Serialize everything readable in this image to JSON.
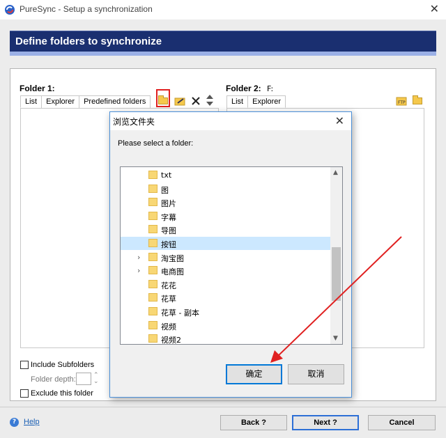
{
  "window": {
    "title": "PureSync - Setup a synchronization",
    "close": "✕"
  },
  "header": {
    "title": "Define folders to synchronize"
  },
  "folder1": {
    "label": "Folder 1:",
    "tabs": [
      "List",
      "Explorer",
      "Predefined folders"
    ]
  },
  "folder2": {
    "label": "Folder 2:",
    "drive": "F:",
    "tabs": [
      "List",
      "Explorer"
    ]
  },
  "options": {
    "include_subfolders": "Include Subfolders",
    "folder_depth": "Folder depth:",
    "exclude_folder": "Exclude this folder"
  },
  "footer": {
    "help": "Help",
    "back": "Back ?",
    "next": "Next ?",
    "cancel": "Cancel"
  },
  "dialog": {
    "title": "浏览文件夹",
    "prompt": "Please select a folder:",
    "folders": [
      {
        "name": "txt",
        "expandable": false,
        "selected": false
      },
      {
        "name": "图",
        "expandable": false,
        "selected": false
      },
      {
        "name": "图片",
        "expandable": false,
        "selected": false
      },
      {
        "name": "字幕",
        "expandable": false,
        "selected": false
      },
      {
        "name": "导图",
        "expandable": false,
        "selected": false
      },
      {
        "name": "按钮",
        "expandable": false,
        "selected": true
      },
      {
        "name": "淘宝图",
        "expandable": true,
        "selected": false
      },
      {
        "name": "电商图",
        "expandable": true,
        "selected": false
      },
      {
        "name": "花花",
        "expandable": false,
        "selected": false
      },
      {
        "name": "花草",
        "expandable": false,
        "selected": false
      },
      {
        "name": "花草 - 副本",
        "expandable": false,
        "selected": false
      },
      {
        "name": "视频",
        "expandable": false,
        "selected": false
      },
      {
        "name": "视频2",
        "expandable": false,
        "selected": false
      }
    ],
    "ok": "确定",
    "cancel": "取消"
  },
  "colors": {
    "header_bg": "#1a2f70",
    "annotation_red": "#e02020",
    "selection": "#cce8ff"
  }
}
